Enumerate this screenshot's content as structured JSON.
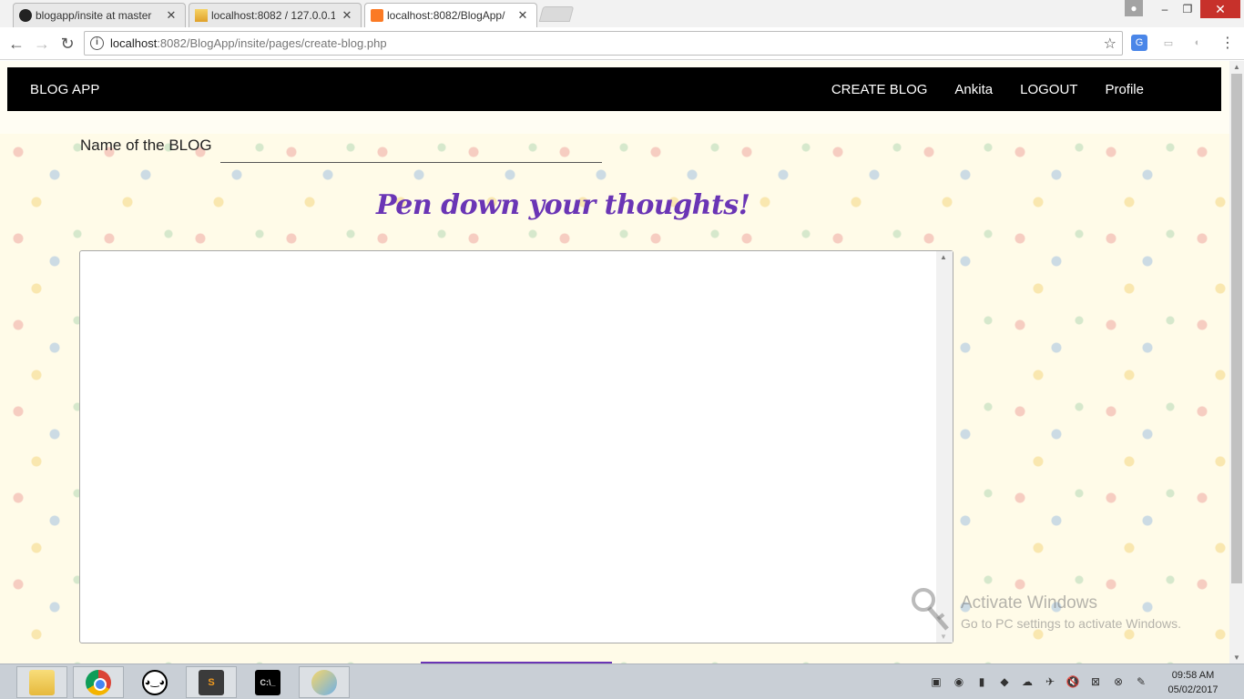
{
  "browser": {
    "tabs": [
      {
        "title": "blogapp/insite at master",
        "favicon": "github-icon",
        "active": false
      },
      {
        "title": "localhost:8082 / 127.0.0.1",
        "favicon": "phpmyadmin-icon",
        "active": false
      },
      {
        "title": "localhost:8082/BlogApp/",
        "favicon": "xampp-icon",
        "active": true
      }
    ],
    "url_host": "localhost",
    "url_rest": ":8082/BlogApp/insite/pages/create-blog.php",
    "window_controls": {
      "minimize": "–",
      "maximize": "❐",
      "close": "✕"
    }
  },
  "page": {
    "navbar": {
      "brand": "BLOG APP",
      "links": [
        "CREATE BLOG",
        "Ankita",
        "LOGOUT",
        "Profile"
      ]
    },
    "blog_name_label": "Name of the BLOG",
    "blog_name_value": "",
    "heading": "Pen down your thoughts!",
    "editor_value": "",
    "accent_color": "#6a35b5"
  },
  "watermark": {
    "title": "Activate Windows",
    "subtitle": "Go to PC settings to activate Windows."
  },
  "taskbar": {
    "apps": [
      "file-explorer-icon",
      "chrome-icon",
      "face-app-icon",
      "sublime-text-icon",
      "command-prompt-icon",
      "paint-icon"
    ],
    "chrome_glyph": "",
    "sublime_glyph": "S",
    "cmd_glyph": "C:\\_",
    "clock_time": "09:58 AM",
    "clock_date": "05/02/2017"
  }
}
